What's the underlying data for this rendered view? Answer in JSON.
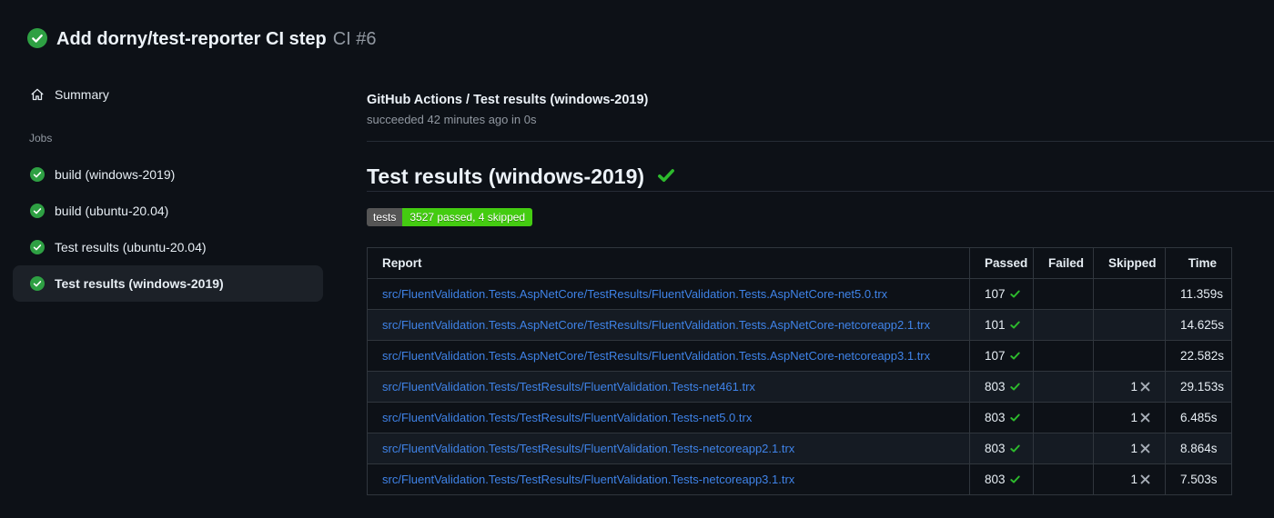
{
  "header": {
    "title": "Add dorny/test-reporter CI step",
    "run_number": "CI #6"
  },
  "sidebar": {
    "summary_label": "Summary",
    "jobs_label": "Jobs",
    "jobs": [
      {
        "label": "build (windows-2019)",
        "selected": false
      },
      {
        "label": "build (ubuntu-20.04)",
        "selected": false
      },
      {
        "label": "Test results (ubuntu-20.04)",
        "selected": false
      },
      {
        "label": "Test results (windows-2019)",
        "selected": true
      }
    ]
  },
  "main": {
    "check_title": "GitHub Actions / Test results (windows-2019)",
    "check_status": "succeeded 42 minutes ago in 0s",
    "heading": "Test results (windows-2019)",
    "badge": {
      "label": "tests",
      "value": "3527 passed, 4 skipped"
    },
    "table": {
      "columns": [
        "Report",
        "Passed",
        "Failed",
        "Skipped",
        "Time"
      ],
      "rows": [
        {
          "report": "src/FluentValidation.Tests.AspNetCore/TestResults/FluentValidation.Tests.AspNetCore-net5.0.trx",
          "passed": "107",
          "failed": "",
          "skipped": "",
          "time": "11.359s"
        },
        {
          "report": "src/FluentValidation.Tests.AspNetCore/TestResults/FluentValidation.Tests.AspNetCore-netcoreapp2.1.trx",
          "passed": "101",
          "failed": "",
          "skipped": "",
          "time": "14.625s"
        },
        {
          "report": "src/FluentValidation.Tests.AspNetCore/TestResults/FluentValidation.Tests.AspNetCore-netcoreapp3.1.trx",
          "passed": "107",
          "failed": "",
          "skipped": "",
          "time": "22.582s"
        },
        {
          "report": "src/FluentValidation.Tests/TestResults/FluentValidation.Tests-net461.trx",
          "passed": "803",
          "failed": "",
          "skipped": "1",
          "time": "29.153s"
        },
        {
          "report": "src/FluentValidation.Tests/TestResults/FluentValidation.Tests-net5.0.trx",
          "passed": "803",
          "failed": "",
          "skipped": "1",
          "time": "6.485s"
        },
        {
          "report": "src/FluentValidation.Tests/TestResults/FluentValidation.Tests-netcoreapp2.1.trx",
          "passed": "803",
          "failed": "",
          "skipped": "1",
          "time": "8.864s"
        },
        {
          "report": "src/FluentValidation.Tests/TestResults/FluentValidation.Tests-netcoreapp3.1.trx",
          "passed": "803",
          "failed": "",
          "skipped": "1",
          "time": "7.503s"
        }
      ]
    }
  },
  "colors": {
    "background": "#0d1117",
    "status_green": "#2ea043",
    "pass_check_green": "#2dba2d",
    "link_blue": "#3f83e8",
    "badge_label_bg": "#555555",
    "badge_value_bg": "#44cc11",
    "selected_item_bg": "#1c2128"
  }
}
